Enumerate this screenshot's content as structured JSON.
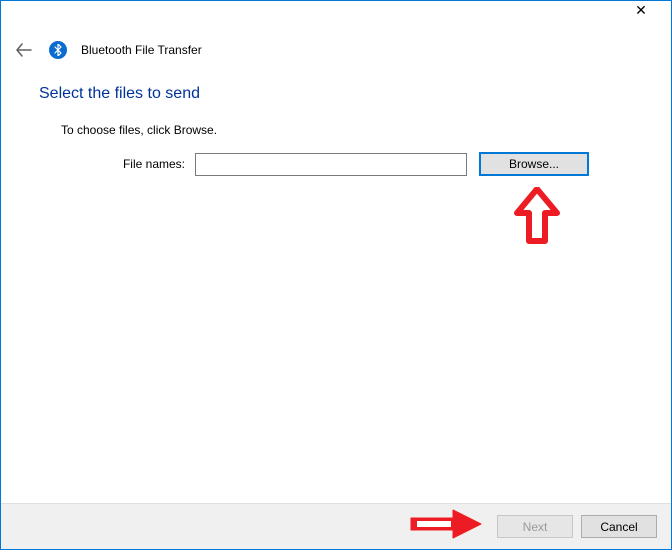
{
  "app": {
    "title": "Bluetooth File Transfer"
  },
  "heading": "Select the files to send",
  "instruction": "To choose files, click Browse.",
  "form": {
    "file_names_label": "File names:",
    "file_names_value": "",
    "browse_label": "Browse..."
  },
  "buttons": {
    "next": "Next",
    "cancel": "Cancel"
  }
}
